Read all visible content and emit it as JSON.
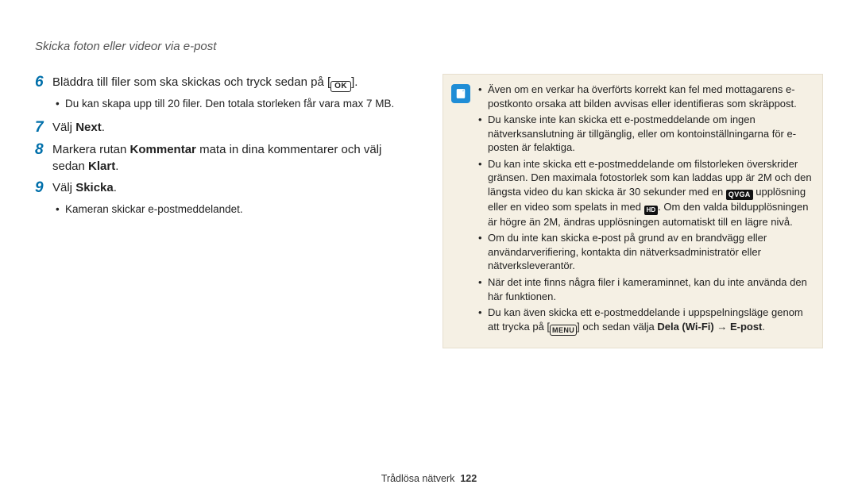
{
  "page_title": "Skicka foton eller videor via e-post",
  "steps": {
    "s6": {
      "num": "6",
      "body_pre": "Bläddra till filer som ska skickas och tryck sedan på [",
      "body_icon": "OK",
      "body_post": "].",
      "sub": "Du kan skapa upp till 20 filer. Den totala storleken får vara max 7 MB."
    },
    "s7": {
      "num": "7",
      "body_pre": "Välj ",
      "body_bold": "Next",
      "body_post": "."
    },
    "s8": {
      "num": "8",
      "body_pre": "Markera rutan ",
      "body_bold1": "Kommentar",
      "body_mid": " mata in dina kommentarer och välj sedan ",
      "body_bold2": "Klart",
      "body_post": "."
    },
    "s9": {
      "num": "9",
      "body_pre": "Välj ",
      "body_bold": "Skicka",
      "body_post": ".",
      "sub": "Kameran skickar e-postmeddelandet."
    }
  },
  "note": {
    "b1": "Även om en verkar ha överförts korrekt kan fel med mottagarens e-postkonto orsaka att bilden avvisas eller identifieras som skräppost.",
    "b2": "Du kanske inte kan skicka ett e-postmeddelande om ingen nätverksanslutning är tillgänglig, eller om kontoinställningarna för e-posten är felaktiga.",
    "b3_pre": "Du kan inte skicka ett e-postmeddelande om filstorleken överskrider gränsen. Den maximala fotostorlek som kan laddas upp är 2M och den längsta video du kan skicka är 30 sekunder med en ",
    "b3_qvga": "QVGA",
    "b3_mid": " upplösning eller en video som spelats in med ",
    "b3_hd": "HD",
    "b3_post": ". Om den valda bildupplösningen är högre än 2M, ändras upplösningen automatiskt till en lägre nivå.",
    "b4": "Om du inte kan skicka e-post på grund av en brandvägg eller användarverifiering, kontakta din nätverksadministratör eller nätverksleverantör.",
    "b5": "När det inte finns några filer i kameraminnet, kan du inte använda den här funktionen.",
    "b6_pre": "Du kan även skicka ett e-postmeddelande i uppspelningsläge genom att trycka på [",
    "b6_menu": "MENU",
    "b6_mid": "] och sedan välja ",
    "b6_bold": "Dela (Wi-Fi) → E-post",
    "b6_post": "."
  },
  "footer": {
    "section": "Trådlösa nätverk",
    "page": "122"
  }
}
